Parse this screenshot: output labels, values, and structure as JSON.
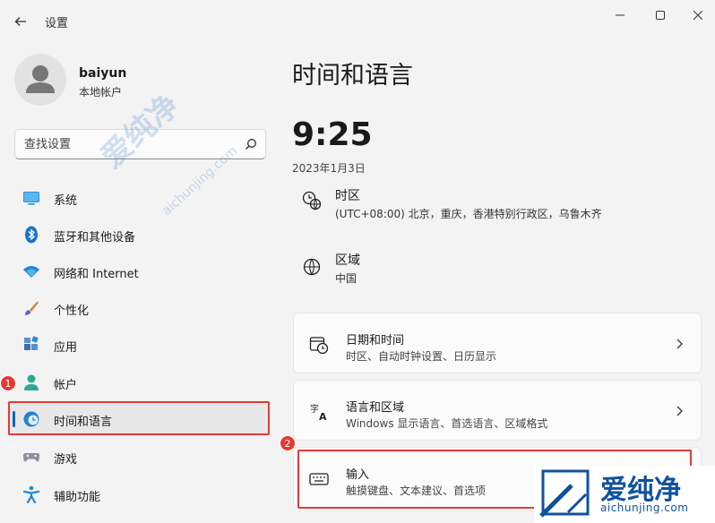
{
  "window": {
    "title": "设置"
  },
  "account": {
    "name": "baiyun",
    "type": "本地帐户"
  },
  "search": {
    "placeholder": "查找设置"
  },
  "nav": [
    {
      "label": "系统",
      "icon": "monitor-icon"
    },
    {
      "label": "蓝牙和其他设备",
      "icon": "bluetooth-icon"
    },
    {
      "label": "网络和 Internet",
      "icon": "wifi-icon"
    },
    {
      "label": "个性化",
      "icon": "brush-icon"
    },
    {
      "label": "应用",
      "icon": "apps-icon"
    },
    {
      "label": "帐户",
      "icon": "person-icon"
    },
    {
      "label": "时间和语言",
      "icon": "clock-globe-icon",
      "selected": true
    },
    {
      "label": "游戏",
      "icon": "gamepad-icon"
    },
    {
      "label": "辅助功能",
      "icon": "accessibility-icon"
    }
  ],
  "annotations": {
    "badge1": "1",
    "badge2": "2"
  },
  "main": {
    "title": "时间和语言",
    "time": "9:25",
    "date": "2023年1月3日",
    "timezone": {
      "label": "时区",
      "value": "(UTC+08:00) 北京，重庆，香港特别行政区，乌鲁木齐"
    },
    "region": {
      "label": "区域",
      "value": "中国"
    },
    "cards": [
      {
        "title": "日期和时间",
        "subtitle": "时区、自动时钟设置、日历显示",
        "icon": "calendar-clock-icon"
      },
      {
        "title": "语言和区域",
        "subtitle": "Windows 显示语言、首选语言、区域格式",
        "icon": "language-icon"
      },
      {
        "title": "输入",
        "subtitle": "触摸键盘、文本建议、首选项",
        "icon": "keyboard-icon"
      }
    ]
  },
  "watermark": {
    "brand": "爱纯净",
    "url": "aichunjing.com"
  },
  "colors": {
    "accent": "#0067c0",
    "annotation": "#e53935",
    "background": "#f3f3f3",
    "watermark": "#10529c"
  }
}
